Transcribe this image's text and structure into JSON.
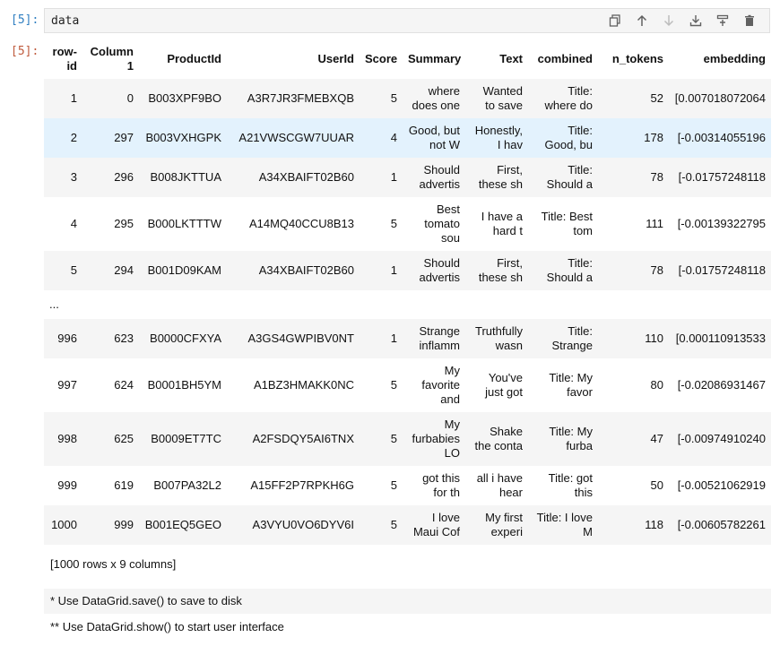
{
  "cell": {
    "input_prompt": "[5]:",
    "output_prompt": "[5]:",
    "code": "data"
  },
  "toolbar": {
    "buttons": [
      {
        "icon": "duplicate-icon"
      },
      {
        "icon": "move-up-icon"
      },
      {
        "icon": "move-down-icon"
      },
      {
        "icon": "insert-below-icon"
      },
      {
        "icon": "insert-above-icon"
      },
      {
        "icon": "delete-icon"
      }
    ]
  },
  "table": {
    "headers": [
      "row-id",
      "Column 1",
      "ProductId",
      "UserId",
      "Score",
      "Summary",
      "Text",
      "combined",
      "n_tokens",
      "embedding"
    ],
    "rows": [
      [
        "1",
        "0",
        "B003XPF9BO",
        "A3R7JR3FMEBXQB",
        "5",
        "where does one",
        "Wanted to save",
        "Title: where do",
        "52",
        "[0.007018072064"
      ],
      [
        "2",
        "297",
        "B003VXHGPK",
        "A21VWSCGW7UUAR",
        "4",
        "Good, but not W",
        "Honestly, I hav",
        "Title: Good, bu",
        "178",
        "[-0.00314055196"
      ],
      [
        "3",
        "296",
        "B008JKTTUA",
        "A34XBAIFT02B60",
        "1",
        "Should advertis",
        "First, these sh",
        "Title: Should a",
        "78",
        "[-0.01757248118"
      ],
      [
        "4",
        "295",
        "B000LKTTTW",
        "A14MQ40CCU8B13",
        "5",
        "Best tomato sou",
        "I have a hard t",
        "Title: Best tom",
        "111",
        "[-0.00139322795"
      ],
      [
        "5",
        "294",
        "B001D09KAM",
        "A34XBAIFT02B60",
        "1",
        "Should advertis",
        "First, these sh",
        "Title: Should a",
        "78",
        "[-0.01757248118"
      ],
      [
        "...",
        "",
        "",
        "",
        "",
        "",
        "",
        "",
        "",
        ""
      ],
      [
        "996",
        "623",
        "B0000CFXYA",
        "A3GS4GWPIBV0NT",
        "1",
        "Strange inflamm",
        "Truthfully wasn",
        "Title: Strange",
        "110",
        "[0.000110913533"
      ],
      [
        "997",
        "624",
        "B0001BH5YM",
        "A1BZ3HMAKK0NC",
        "5",
        "My favorite and",
        "You've just got",
        "Title: My favor",
        "80",
        "[-0.02086931467"
      ],
      [
        "998",
        "625",
        "B0009ET7TC",
        "A2FSDQY5AI6TNX",
        "5",
        "My furbabies LO",
        "Shake the conta",
        "Title: My furba",
        "47",
        "[-0.00974910240"
      ],
      [
        "999",
        "619",
        "B007PA32L2",
        "A15FF2P7RPKH6G",
        "5",
        "got this for th",
        "all i have hear",
        "Title: got this",
        "50",
        "[-0.00521062919"
      ],
      [
        "1000",
        "999",
        "B001EQ5GEO",
        "A3VYU0VO6DYV6I",
        "5",
        "I love Maui Cof",
        "My first experi",
        "Title: I love M",
        "118",
        "[-0.00605782261"
      ]
    ],
    "selected_row_index": 1,
    "ellipsis_row_index": 5
  },
  "caption": "[1000 rows x 9 columns]",
  "notes": [
    "* Use DataGrid.save() to save to disk",
    "** Use DataGrid.show() to start user interface"
  ]
}
